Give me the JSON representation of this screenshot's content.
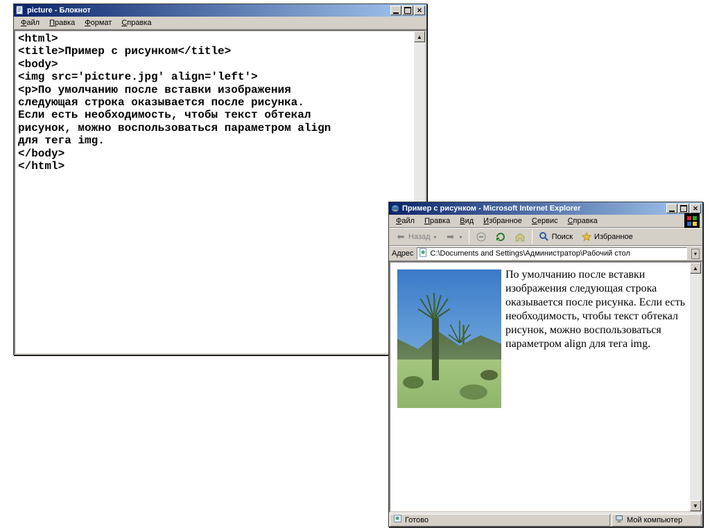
{
  "notepad": {
    "title": "picture - Блокнот",
    "menu": [
      "Файл",
      "Правка",
      "Формат",
      "Справка"
    ],
    "content": "<html>\n<title>Пример с рисунком</title>\n<body>\n<img src='picture.jpg' align='left'>\n<p>По умолчанию после вставки изображения\nследующая строка оказывается после рисунка.\nЕсли есть необходимость, чтобы текст обтекал\nрисунок, можно воспользоваться параметром align\nдля тега img.\n</body>\n</html>"
  },
  "ie": {
    "title": "Пример с рисунком - Microsoft Internet Explorer",
    "menu": [
      "Файл",
      "Правка",
      "Вид",
      "Избранное",
      "Сервис",
      "Справка"
    ],
    "toolbar": {
      "back": "Назад",
      "search": "Поиск",
      "favorites": "Избранное"
    },
    "address_label": "Адрес",
    "address_value": "C:\\Documents and Settings\\Администратор\\Рабочий стол",
    "body_text": "По умолчанию после вставки изображения следующая строка оказывается после рисунка. Если есть необходимость, чтобы текст обтекал рисунок, можно воспользоваться параметром align для тега img.",
    "status_left": "Готово",
    "status_right": "Мой компьютер"
  }
}
